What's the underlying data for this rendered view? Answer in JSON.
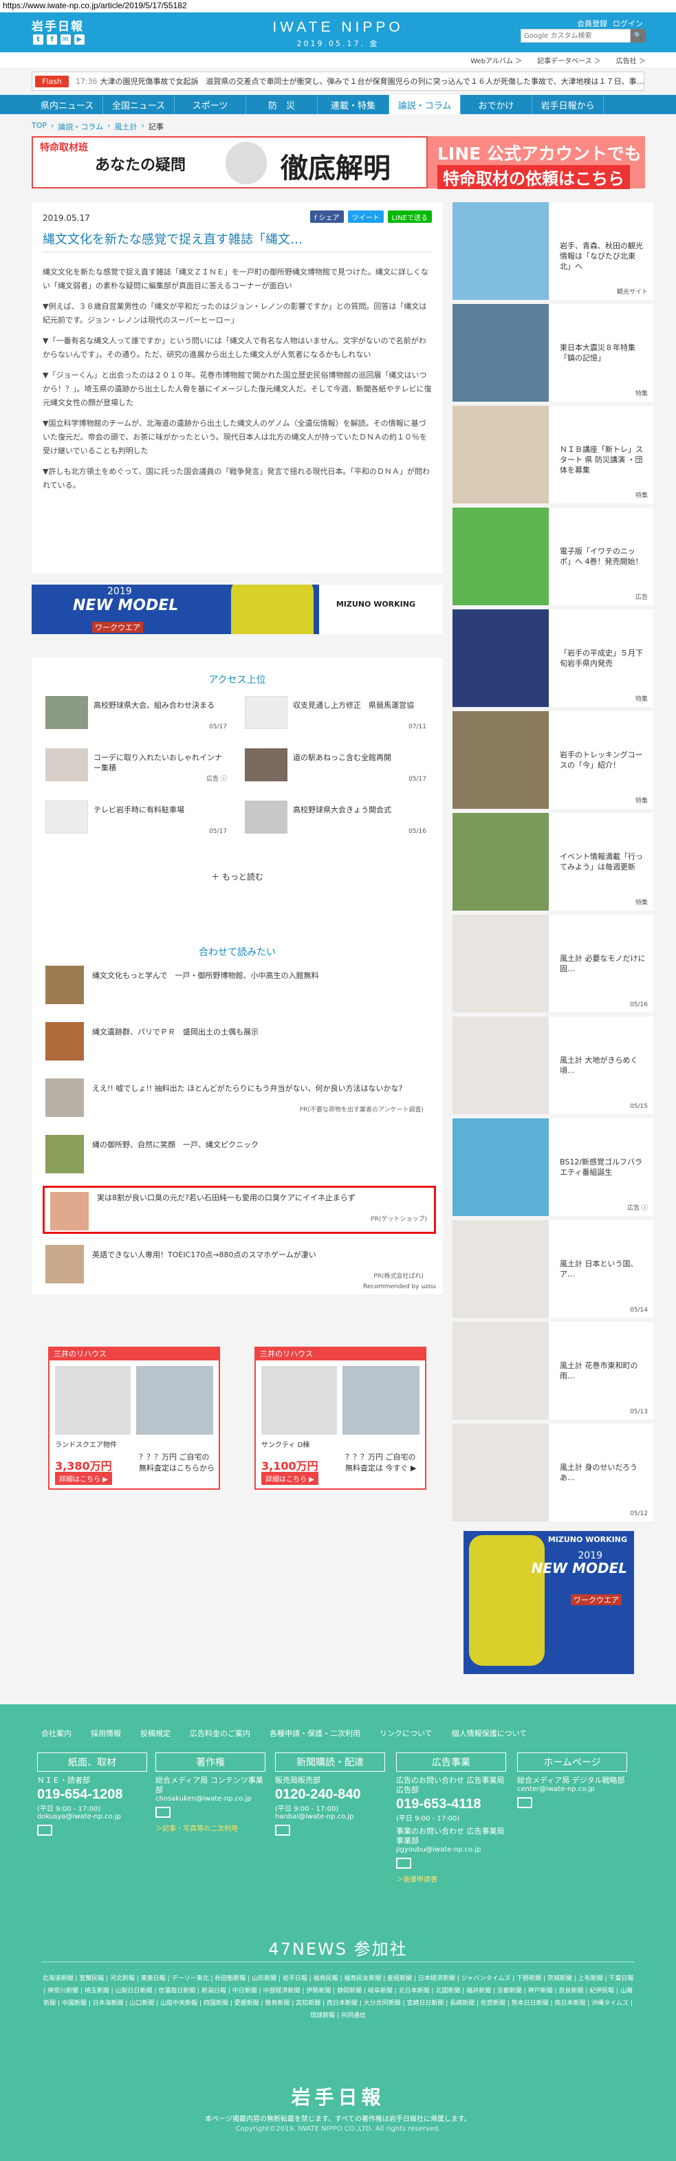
{
  "browser": {
    "url": "https://www.iwate-np.co.jp/article/2019/5/17/55182"
  },
  "header": {
    "logo": "岩手日報",
    "brand": "IWATE NIPPO",
    "date": "2019.05.17. 金",
    "member_register": "会員登録",
    "login": "ログイン",
    "search_placeholder": "Google カスタム検索",
    "search_button": "🔍",
    "sns": [
      "t",
      "f",
      "✉",
      "▶"
    ],
    "subnav": [
      "Webアルバム ＞",
      "記事データベース ＞",
      "広告社 ＞"
    ]
  },
  "flash": {
    "label": "Flash",
    "time": "17:36",
    "text": "大津の園児死傷事故で女起訴　滋賀県の交差点で車同士が衝突し、弾みで１台が保育園児らの列に突っ込んで１６人が死傷した事故で、大津地検は１７日、事…"
  },
  "nav": [
    "県内ニュース",
    "全国ニュース",
    "スポーツ",
    "防　災",
    "連載・特集",
    "論説・コラム",
    "おでかけ",
    "岩手日報から"
  ],
  "breadcrumb": [
    "TOP",
    "論説・コラム",
    "風土計",
    "記事"
  ],
  "top_banner": {
    "left_manga": "特命取材班",
    "left_mid": "あなたの疑問",
    "left_big": "徹底解明",
    "right1": "LINE 公式アカウントでも受付",
    "right2": "特命取材の依頼はこちら"
  },
  "article": {
    "date": "2019.05.17",
    "share": [
      "f シェア",
      "ツイート",
      "LINEで送る"
    ],
    "title": "縄文文化を新たな感覚で捉え直す雑誌「縄文…",
    "paragraphs": [
      "縄文文化を新たな感覚で捉え直す雑誌「縄文ＺＩＮＥ」を一戸町の御所野縄文博物館で見つけた。縄文に詳しくない「縄文弱者」の素朴な疑問に編集部が真面目に答えるコーナーが面白い",
      "▼例えば、３８歳自営業男性の「縄文が平和だったのはジョン・レノンの影響ですか」との質問。回答は「縄文は紀元前です。ジョン・レノンは現代のスーパーヒーロー」",
      "▼「一番有名な縄文人って誰ですか」という問いには「縄文人で有名な人物はいません。文字がないので名前がわからないんです」。その通り。ただ、研究の進展から出土した縄文人が人気者になるかもしれない",
      "▼「ジョーくん」と出会ったのは２０１０年。花巻市博物館で開かれた国立歴史民俗博物館の巡回展「縄文はいつから！？」。埼玉県の遺跡から出土した人骨を基にイメージした復元縄文人だ。そして今週、新聞各紙やテレビに復元縄文女性の顔が登場した",
      "▼国立科学博物館のチームが、北海道の遺跡から出土した縄文人のゲノム（全遺伝情報）を解読。その情報に基づいた復元だ。帝会の頭で、お茶に味がかったという。現代日本人は北方の縄文人が持っていたＤＮＡの約１０％を受け継いでいることも判明した",
      "▼許しも北方領土をめぐって、国に託った国会議員の「戦争発言」発言で揺れる現代日本。「平和のＤＮＡ」が問われている。"
    ]
  },
  "ad_wide": {
    "year": "2019",
    "model": "NEW MODEL",
    "sub": "ワークウエア",
    "brand": "MIZUNO WORKING"
  },
  "ranking": {
    "title": "アクセス上位",
    "items": [
      {
        "title": "高校野球県大会、組み合わせ決まる",
        "date": "05/17"
      },
      {
        "title": "収支見通し上方修正　県競馬運営協",
        "date": "07/11"
      },
      {
        "title": "コーデに取り入れたいおしゃれインナー集積",
        "date": "広告 ⓘ"
      },
      {
        "title": "道の駅あねっこ含む全館再開",
        "date": "05/17"
      },
      {
        "title": "テレビ岩手時に有料駐車場",
        "date": "05/17"
      },
      {
        "title": "高校野球県大会きょう開会式",
        "date": "05/16"
      }
    ],
    "more": "＋ もっと読む"
  },
  "recommend": {
    "title": "合わせて読みたい",
    "items": [
      {
        "title": "縄文文化もっと学んで　一戸・御所野博物館、小中高生の入館無料",
        "src": ""
      },
      {
        "title": "縄文遺跡群、パリでＰＲ　盛岡出土の土偶も展示",
        "src": ""
      },
      {
        "title": "ええ!! 嘘でしょ!! 抽料出た ほとんどがたらりにもう弁当がない、何か良い方法はないかな?",
        "src": "PR(不要な荷物を出す業者のアンケート調査)"
      },
      {
        "title": "縄の御所野、自然に笑顔　一戸、縄文ピクニック",
        "src": ""
      },
      {
        "title": "実は8割が良い口臭の元だ?若い石田純一も愛用の口臭ケアにイイネ止まらず",
        "src": "PR(ゲットショップ)"
      },
      {
        "title": "英語できない人専用！TOEIC170点→880点のスマホゲームが凄い",
        "src": "PR(株式会社ぱれ)"
      }
    ],
    "footer": "Recommended by uzou"
  },
  "prop_ads": [
    {
      "head": "三井のリハウス",
      "name": "ランドスクエア物件",
      "price": "3,380万円",
      "btn": "詳細はこちら ▶",
      "q": "？？？万円 ご自宅の無料査定はこちらから"
    },
    {
      "head": "三井のリハウス",
      "name": "サンクティ D棟",
      "price": "3,100万円",
      "btn": "詳細はこちら ▶",
      "q": "？？？万円 ご自宅の無料査定は 今すぐ ▶"
    }
  ],
  "sidebar": [
    {
      "title": "岩手、青森、秋田の観光情報は「なびたび北東北」へ",
      "caption": "観光サイト"
    },
    {
      "title": "東日本大震災８年特集「鎮の記憶」",
      "caption": "特集"
    },
    {
      "title": "ＮＩＢ講座「新トレ」スタート 県 防災講演 ・団体を募集",
      "caption": "特集"
    },
    {
      "title": "電子版「イワテのニッポ」へ 4巻！発売開始！",
      "caption": "広告"
    },
    {
      "title": "「岩手の平成史」５月下旬岩手県内発売",
      "caption": "特集"
    },
    {
      "title": "岩手のトレッキングコースの「今」紹介！",
      "caption": "特集"
    },
    {
      "title": "イベント情報満載「行ってみよう」は毎週更新",
      "caption": "特集"
    },
    {
      "title": "風土計 必要なモノだけに固…",
      "caption": "05/16"
    },
    {
      "title": "風土計 大地がきらめく頃…",
      "caption": "05/15"
    },
    {
      "title": "BS12/新感覚ゴルフバラエティ番組誕生",
      "caption": "広告 ⓘ"
    },
    {
      "title": "風土計 日本という国、ア…",
      "caption": "05/14"
    },
    {
      "title": "風土計 花巻市東和町の雨…",
      "caption": "05/13"
    },
    {
      "title": "風土計 身のせいだろう あ…",
      "caption": "05/12"
    }
  ],
  "side_ad": {
    "brand": "MIZUNO WORKING",
    "year": "2019",
    "model": "NEW MODEL",
    "sub": "ワークウエア"
  },
  "footer": {
    "links": [
      "会社案内",
      "採用情報",
      "投稿規定",
      "広告料金のご案内",
      "各種申請・保護・二次利用",
      "リンクについて",
      "個人情報保護について"
    ],
    "cols": [
      {
        "head": "紙面、取材",
        "label": "ＮＩＥ・読者部",
        "tel": "019-654-1208",
        "hours": "(平日 9:00 - 17:00)",
        "mail": "dokusya@iwate-np.co.jp",
        "extra": ""
      },
      {
        "head": "著作権",
        "label": "総合メディア局 コンテンツ事業部",
        "tel": "",
        "hours": "",
        "mail": "chosakuken@iwate-np.co.jp",
        "extra": "＞記事・写真等の二次利用"
      },
      {
        "head": "新聞購読・配達",
        "label": "販売局販売部",
        "tel": "0120-240-840",
        "hours": "(平日 9:00 - 17:00)",
        "mail": "hanbai@iwate-np.co.jp",
        "extra": ""
      },
      {
        "head": "広告事業",
        "label": "広告のお問い合わせ 広告事業局広告部",
        "tel": "019-653-4118",
        "hours": "(平日 9:00 - 17:00)",
        "mail": "jigyoubu@iwate-np.co.jp",
        "extra": "＞後援申請書"
      },
      {
        "head": "ホームページ",
        "label": "総合メディア局 デジタル戦略部",
        "tel": "",
        "hours": "",
        "mail": "center@iwate-np.co.jp",
        "extra": ""
      }
    ],
    "col4_sub": "事業のお問い合わせ 広告事業局事業部",
    "title47": "47NEWS 参加社",
    "papers": "北海道新聞 | 室蘭民報 | 河北新報 | 東奥日報 | デーリー東北 | 秋田魁新報 | 山形新聞 | 岩手日報 | 福島民報 | 福島民友新聞 | 産経新聞 | 日本経済新聞 | ジャパンタイムズ | 下野新聞 | 茨城新聞 | 上毛新聞 | 千葉日報 | 神奈川新聞 | 埼玉新聞 | 山梨日日新聞 | 信濃毎日新聞 | 新潟日報 | 中日新聞 | 中部経済新聞 | 伊勢新聞 | 静岡新聞 | 岐阜新聞 | 北日本新聞 | 北國新聞 | 福井新聞 | 京都新聞 | 神戸新聞 | 奈良新聞 | 紀伊民報 | 山陽新聞 | 中国新聞 | 日本海新聞 | 山口新聞 | 山陰中央新報 | 四国新聞 | 愛媛新聞 | 徳島新聞 | 高知新聞 | 西日本新聞 | 大分合同新聞 | 宮崎日日新聞 | 長崎新聞 | 佐賀新聞 | 熊本日日新聞 | 南日本新聞 | 沖縄タイムス | 琉球新報 | 共同通信",
    "logo": "岩手日報",
    "copy1": "本ページ掲載内容の無断転載を禁じます。すべての著作権は岩手日報社に帰属します。",
    "copy2": "Copyright©2019, IWATE NIPPO CO.,LTD. All rights reserved."
  }
}
